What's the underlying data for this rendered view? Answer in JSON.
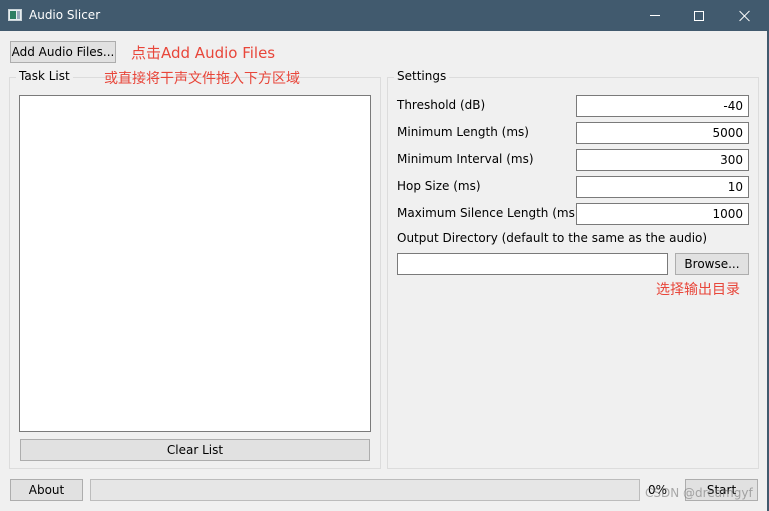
{
  "window": {
    "title": "Audio Slicer",
    "controls": {
      "minimize": "minimize",
      "maximize": "maximize",
      "close": "close"
    }
  },
  "toolbar": {
    "add_files_label": "Add Audio Files..."
  },
  "annotations": {
    "add_hint": "点击Add Audio Files",
    "drag_hint": "或直接将干声文件拖入下方区域",
    "browse_hint": "选择输出目录"
  },
  "task_list": {
    "title": "Task List",
    "items": [],
    "clear_label": "Clear List"
  },
  "settings": {
    "title": "Settings",
    "fields": [
      {
        "label": "Threshold (dB)",
        "value": "-40"
      },
      {
        "label": "Minimum Length (ms)",
        "value": "5000"
      },
      {
        "label": "Minimum Interval (ms)",
        "value": "300"
      },
      {
        "label": "Hop Size (ms)",
        "value": "10"
      },
      {
        "label": "Maximum Silence Length (ms)",
        "value": "1000"
      }
    ],
    "output_dir_label": "Output Directory (default to the same as the audio)",
    "output_dir_value": "",
    "browse_label": "Browse..."
  },
  "footer": {
    "about_label": "About",
    "progress_percent": 0,
    "progress_text": "0%",
    "start_label": "Start"
  },
  "watermark": "CSDN @dreamgyf"
}
